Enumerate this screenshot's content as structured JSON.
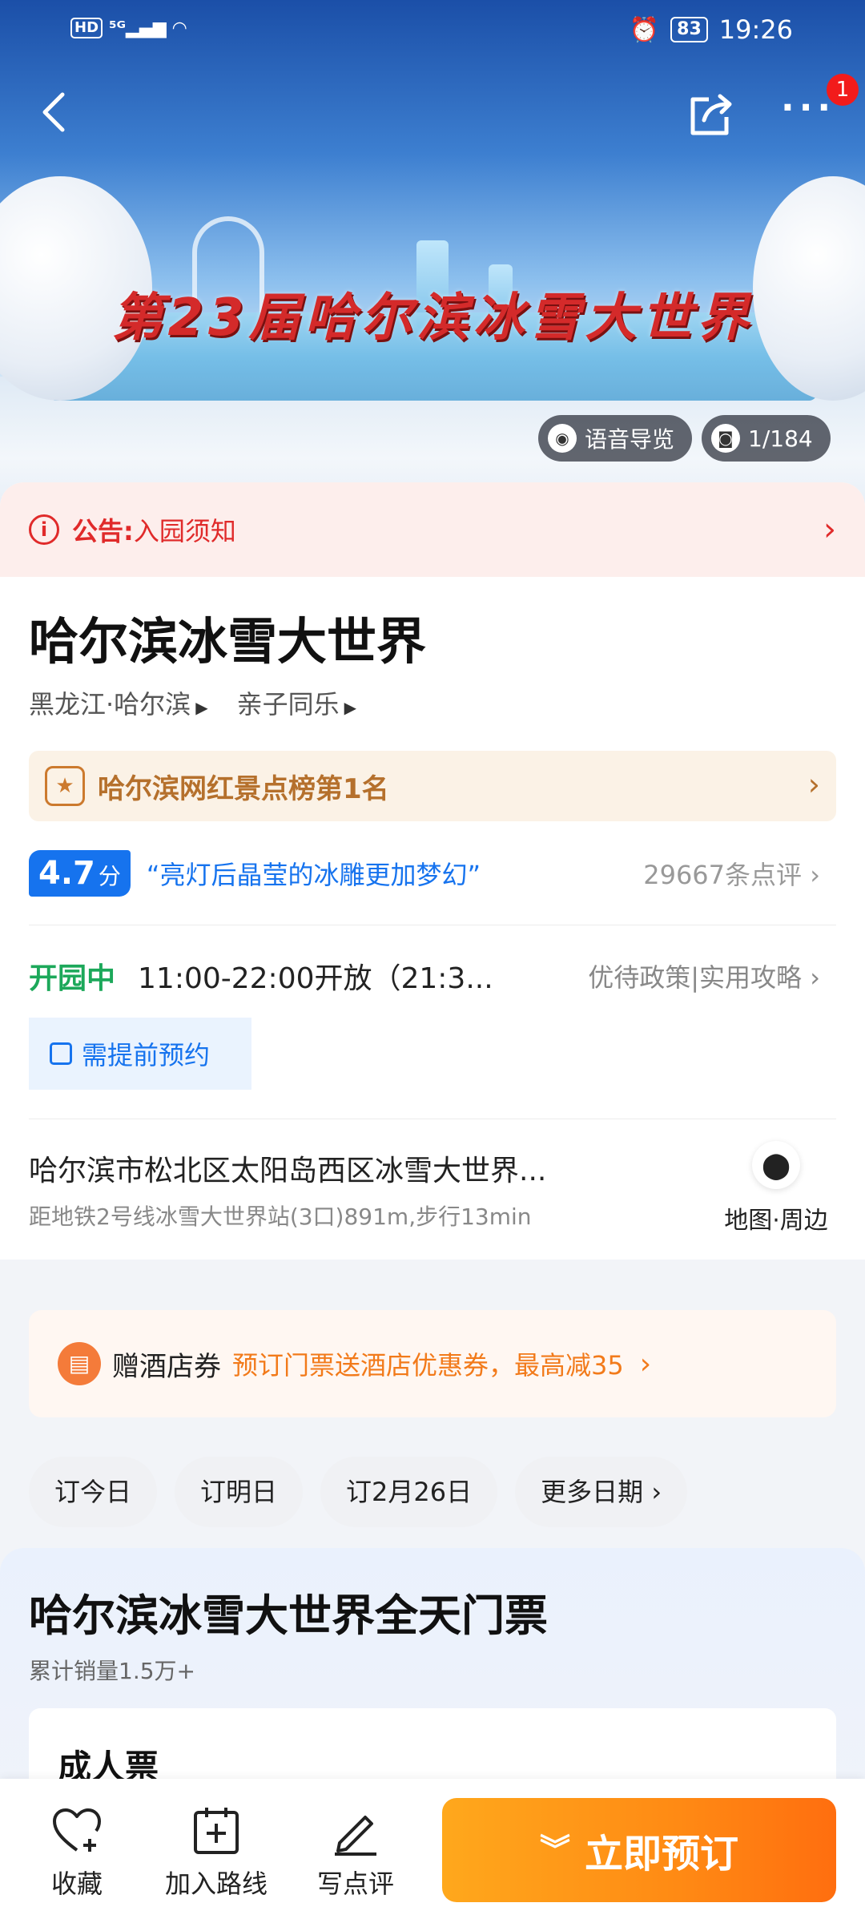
{
  "status_bar": {
    "left": "HD 5G",
    "battery": "83",
    "time": "19:26"
  },
  "hero": {
    "banner_text": "第23届哈尔滨冰雪大世界",
    "audio_guide": "语音导览",
    "photo_count": "1/184",
    "more_badge": "1"
  },
  "notice": {
    "label": "公告:",
    "text": "入园须知"
  },
  "attraction": {
    "title": "哈尔滨冰雪大世界",
    "location": "黑龙江·哈尔滨",
    "category": "亲子同乐",
    "rank_text": "哈尔滨网红景点榜第1名",
    "score": "4.7",
    "score_unit": "分",
    "quote": "“亮灯后晶莹的冰雕更加梦幻”",
    "reviews": "29667条点评",
    "open_status": "开园中",
    "hours": "11:00-22:00开放（21:3...",
    "policy": "优待政策|实用攻略",
    "reserve_note": "需提前预约",
    "address": "哈尔滨市松北区太阳岛西区冰雪大世界...",
    "metro": "距地铁2号线冰雪大世界站(3口)891m,步行13min",
    "map_label": "地图·周边"
  },
  "coupon": {
    "label": "赠酒店券",
    "text": "预订门票送酒店优惠券，最高减35"
  },
  "date_chips": [
    "订今日",
    "订明日",
    "订2月26日",
    "更多日期"
  ],
  "ticket": {
    "title": "哈尔滨冰雪大世界全天门票",
    "sales": "累计销量1.5万+",
    "type": "成人票"
  },
  "bottom_bar": {
    "favorite": "收藏",
    "add_route": "加入路线",
    "review": "写点评",
    "book": "立即预订"
  },
  "colors": {
    "accent_blue": "#1673ee",
    "alert_red": "#e02a2a",
    "open_green": "#1ca85a",
    "book_orange": "#ff8a14"
  }
}
